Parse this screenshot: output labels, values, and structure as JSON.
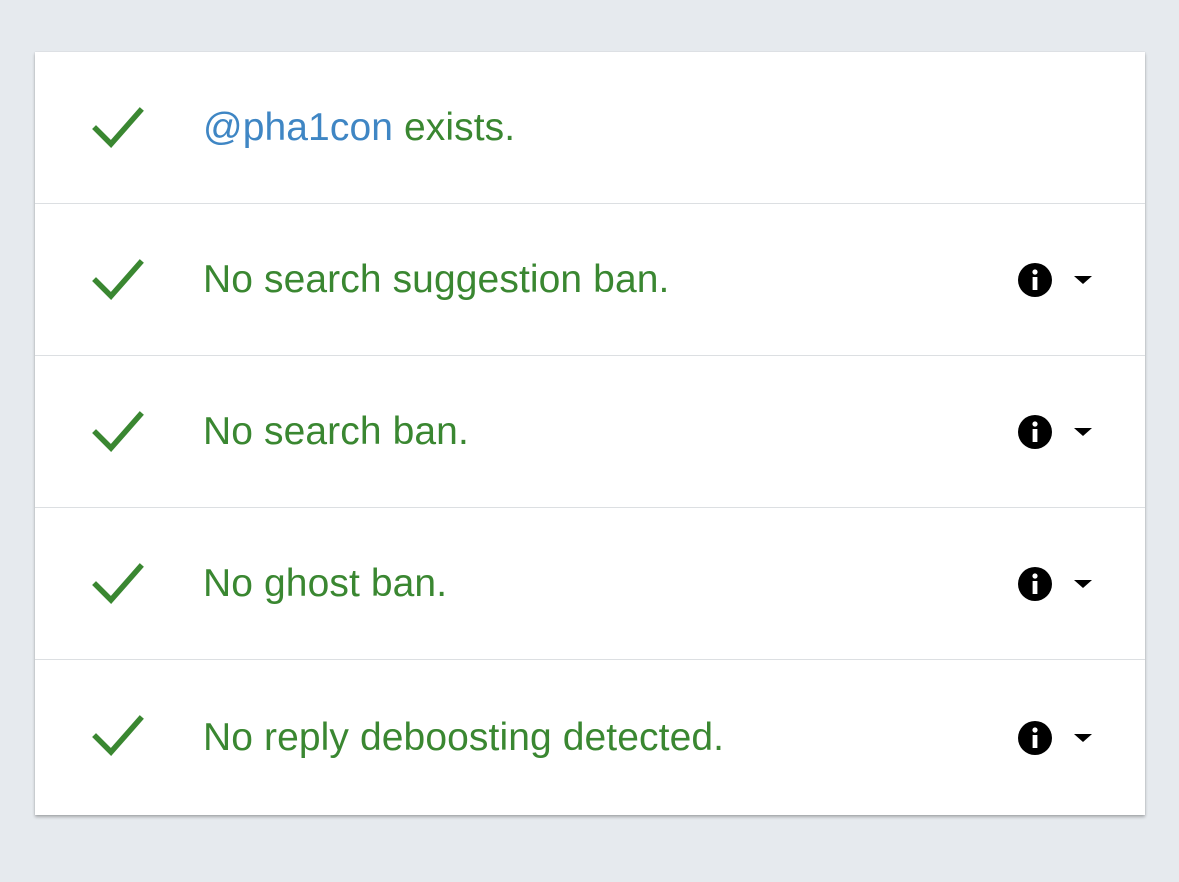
{
  "colors": {
    "page_background": "#e6eaee",
    "card_background": "#ffffff",
    "success_green": "#3a8731",
    "handle_blue": "#3f86c4",
    "icon_black": "#000000"
  },
  "results": {
    "account": {
      "icon": "checkmark-icon",
      "handle": "@pha1con",
      "text": " exists."
    },
    "search_suggestion": {
      "icon": "checkmark-icon",
      "text": "No search suggestion ban."
    },
    "search": {
      "icon": "checkmark-icon",
      "text": "No search ban."
    },
    "ghost": {
      "icon": "checkmark-icon",
      "text": "No ghost ban."
    },
    "reply": {
      "icon": "checkmark-icon",
      "text": "No reply deboosting detected."
    }
  }
}
